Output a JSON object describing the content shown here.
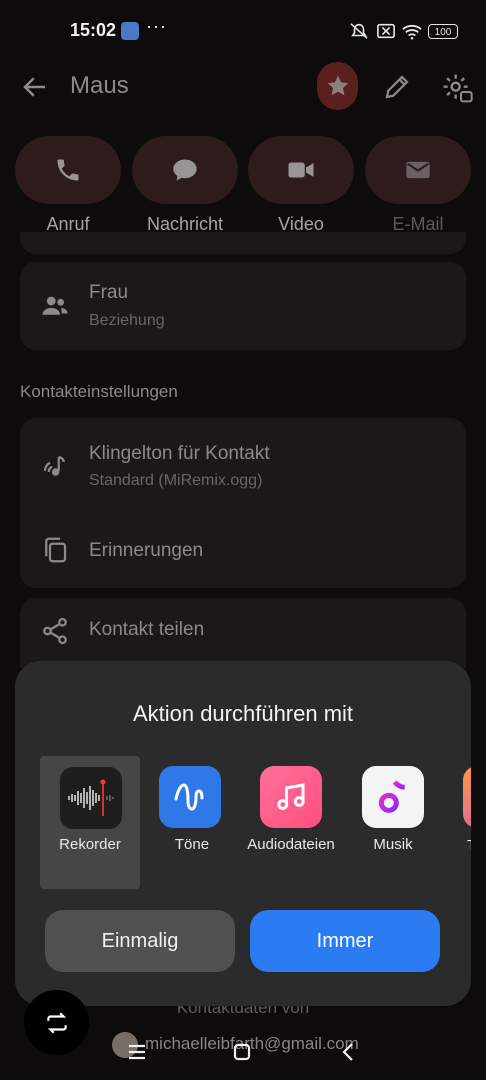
{
  "status_bar": {
    "time": "15:02",
    "dots": "···",
    "battery": "100"
  },
  "header": {
    "title": "Maus"
  },
  "actions": [
    {
      "label": "Anruf",
      "icon": "phone-icon"
    },
    {
      "label": "Nachricht",
      "icon": "message-icon"
    },
    {
      "label": "Video",
      "icon": "video-icon"
    },
    {
      "label": "E-Mail",
      "icon": "mail-icon"
    }
  ],
  "relation": {
    "title": "Frau",
    "subtitle": "Beziehung"
  },
  "contact_settings": {
    "section_title": "Kontakteinstellungen",
    "ringtone_title": "Klingelton für Kontakt",
    "ringtone_value": "Standard (MiRemix.ogg)",
    "reminders_title": "Erinnerungen",
    "share_title": "Kontakt teilen"
  },
  "sheet": {
    "title": "Aktion durchführen mit",
    "apps": [
      {
        "label": "Rekorder",
        "icon": "recorder-icon",
        "selected": true
      },
      {
        "label": "Töne",
        "icon": "tones-icon"
      },
      {
        "label": "Audiodateien",
        "icon": "audio-files-icon"
      },
      {
        "label": "Musik",
        "icon": "music-icon"
      },
      {
        "label": "T",
        "icon": "partial-app-icon"
      }
    ],
    "once_label": "Einmalig",
    "always_label": "Immer"
  },
  "footer": {
    "contact_data_from": "Kontaktdaten von",
    "account_email": "michaelleibfarth@gmail.com"
  },
  "colors": {
    "accent_blue": "#2b7bf2",
    "star_bg": "#5a1f1f",
    "sheet_bg": "#2b2b2b"
  }
}
